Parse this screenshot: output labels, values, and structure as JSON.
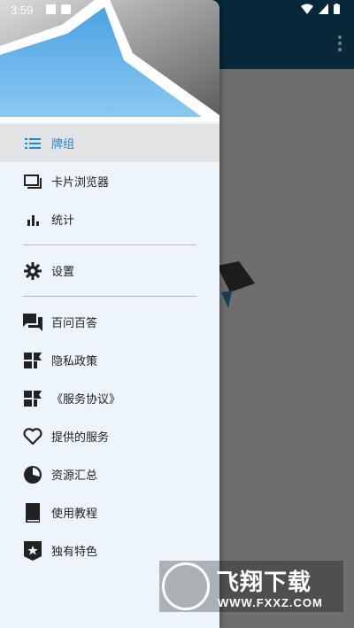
{
  "status_bar": {
    "time": "3:59"
  },
  "drawer": {
    "items": [
      {
        "label": "牌组",
        "icon": "list-icon",
        "active": true
      },
      {
        "label": "卡片浏览器",
        "icon": "card-browser-icon"
      },
      {
        "label": "统计",
        "icon": "bar-chart-icon"
      },
      {
        "label": "设置",
        "icon": "gear-icon"
      },
      {
        "label": "百问百答",
        "icon": "forum-icon"
      },
      {
        "label": "隐私政策",
        "icon": "policy-icon"
      },
      {
        "label": "《服务协议》",
        "icon": "policy-icon"
      },
      {
        "label": "提供的服务",
        "icon": "heart-icon"
      },
      {
        "label": "资源汇总",
        "icon": "pie-chart-icon"
      },
      {
        "label": "使用教程",
        "icon": "book-icon"
      },
      {
        "label": "独有特色",
        "icon": "star-badge-icon"
      }
    ]
  },
  "watermark": {
    "main": "飞翔下载",
    "sub": "WWW.FXXZ.COM"
  },
  "colors": {
    "accent": "#1e88e5",
    "app_bar": "#0f4462",
    "drawer_bg": "#eef5fa",
    "header_blue": "#62b1e8"
  }
}
